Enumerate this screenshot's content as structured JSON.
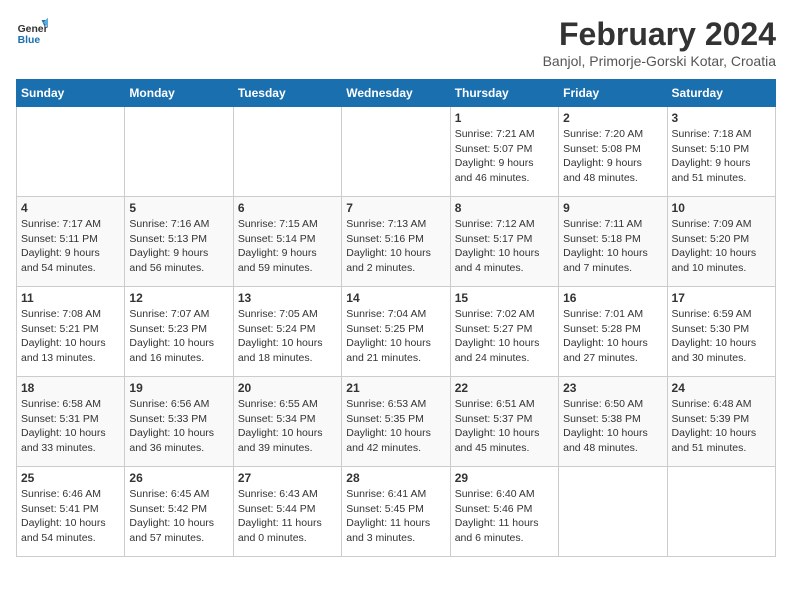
{
  "header": {
    "logo_general": "General",
    "logo_blue": "Blue",
    "month_year": "February 2024",
    "location": "Banjol, Primorje-Gorski Kotar, Croatia"
  },
  "days_of_week": [
    "Sunday",
    "Monday",
    "Tuesday",
    "Wednesday",
    "Thursday",
    "Friday",
    "Saturday"
  ],
  "weeks": [
    [
      {
        "day": "",
        "info": ""
      },
      {
        "day": "",
        "info": ""
      },
      {
        "day": "",
        "info": ""
      },
      {
        "day": "",
        "info": ""
      },
      {
        "day": "1",
        "info": "Sunrise: 7:21 AM\nSunset: 5:07 PM\nDaylight: 9 hours\nand 46 minutes."
      },
      {
        "day": "2",
        "info": "Sunrise: 7:20 AM\nSunset: 5:08 PM\nDaylight: 9 hours\nand 48 minutes."
      },
      {
        "day": "3",
        "info": "Sunrise: 7:18 AM\nSunset: 5:10 PM\nDaylight: 9 hours\nand 51 minutes."
      }
    ],
    [
      {
        "day": "4",
        "info": "Sunrise: 7:17 AM\nSunset: 5:11 PM\nDaylight: 9 hours\nand 54 minutes."
      },
      {
        "day": "5",
        "info": "Sunrise: 7:16 AM\nSunset: 5:13 PM\nDaylight: 9 hours\nand 56 minutes."
      },
      {
        "day": "6",
        "info": "Sunrise: 7:15 AM\nSunset: 5:14 PM\nDaylight: 9 hours\nand 59 minutes."
      },
      {
        "day": "7",
        "info": "Sunrise: 7:13 AM\nSunset: 5:16 PM\nDaylight: 10 hours\nand 2 minutes."
      },
      {
        "day": "8",
        "info": "Sunrise: 7:12 AM\nSunset: 5:17 PM\nDaylight: 10 hours\nand 4 minutes."
      },
      {
        "day": "9",
        "info": "Sunrise: 7:11 AM\nSunset: 5:18 PM\nDaylight: 10 hours\nand 7 minutes."
      },
      {
        "day": "10",
        "info": "Sunrise: 7:09 AM\nSunset: 5:20 PM\nDaylight: 10 hours\nand 10 minutes."
      }
    ],
    [
      {
        "day": "11",
        "info": "Sunrise: 7:08 AM\nSunset: 5:21 PM\nDaylight: 10 hours\nand 13 minutes."
      },
      {
        "day": "12",
        "info": "Sunrise: 7:07 AM\nSunset: 5:23 PM\nDaylight: 10 hours\nand 16 minutes."
      },
      {
        "day": "13",
        "info": "Sunrise: 7:05 AM\nSunset: 5:24 PM\nDaylight: 10 hours\nand 18 minutes."
      },
      {
        "day": "14",
        "info": "Sunrise: 7:04 AM\nSunset: 5:25 PM\nDaylight: 10 hours\nand 21 minutes."
      },
      {
        "day": "15",
        "info": "Sunrise: 7:02 AM\nSunset: 5:27 PM\nDaylight: 10 hours\nand 24 minutes."
      },
      {
        "day": "16",
        "info": "Sunrise: 7:01 AM\nSunset: 5:28 PM\nDaylight: 10 hours\nand 27 minutes."
      },
      {
        "day": "17",
        "info": "Sunrise: 6:59 AM\nSunset: 5:30 PM\nDaylight: 10 hours\nand 30 minutes."
      }
    ],
    [
      {
        "day": "18",
        "info": "Sunrise: 6:58 AM\nSunset: 5:31 PM\nDaylight: 10 hours\nand 33 minutes."
      },
      {
        "day": "19",
        "info": "Sunrise: 6:56 AM\nSunset: 5:33 PM\nDaylight: 10 hours\nand 36 minutes."
      },
      {
        "day": "20",
        "info": "Sunrise: 6:55 AM\nSunset: 5:34 PM\nDaylight: 10 hours\nand 39 minutes."
      },
      {
        "day": "21",
        "info": "Sunrise: 6:53 AM\nSunset: 5:35 PM\nDaylight: 10 hours\nand 42 minutes."
      },
      {
        "day": "22",
        "info": "Sunrise: 6:51 AM\nSunset: 5:37 PM\nDaylight: 10 hours\nand 45 minutes."
      },
      {
        "day": "23",
        "info": "Sunrise: 6:50 AM\nSunset: 5:38 PM\nDaylight: 10 hours\nand 48 minutes."
      },
      {
        "day": "24",
        "info": "Sunrise: 6:48 AM\nSunset: 5:39 PM\nDaylight: 10 hours\nand 51 minutes."
      }
    ],
    [
      {
        "day": "25",
        "info": "Sunrise: 6:46 AM\nSunset: 5:41 PM\nDaylight: 10 hours\nand 54 minutes."
      },
      {
        "day": "26",
        "info": "Sunrise: 6:45 AM\nSunset: 5:42 PM\nDaylight: 10 hours\nand 57 minutes."
      },
      {
        "day": "27",
        "info": "Sunrise: 6:43 AM\nSunset: 5:44 PM\nDaylight: 11 hours\nand 0 minutes."
      },
      {
        "day": "28",
        "info": "Sunrise: 6:41 AM\nSunset: 5:45 PM\nDaylight: 11 hours\nand 3 minutes."
      },
      {
        "day": "29",
        "info": "Sunrise: 6:40 AM\nSunset: 5:46 PM\nDaylight: 11 hours\nand 6 minutes."
      },
      {
        "day": "",
        "info": ""
      },
      {
        "day": "",
        "info": ""
      }
    ]
  ]
}
